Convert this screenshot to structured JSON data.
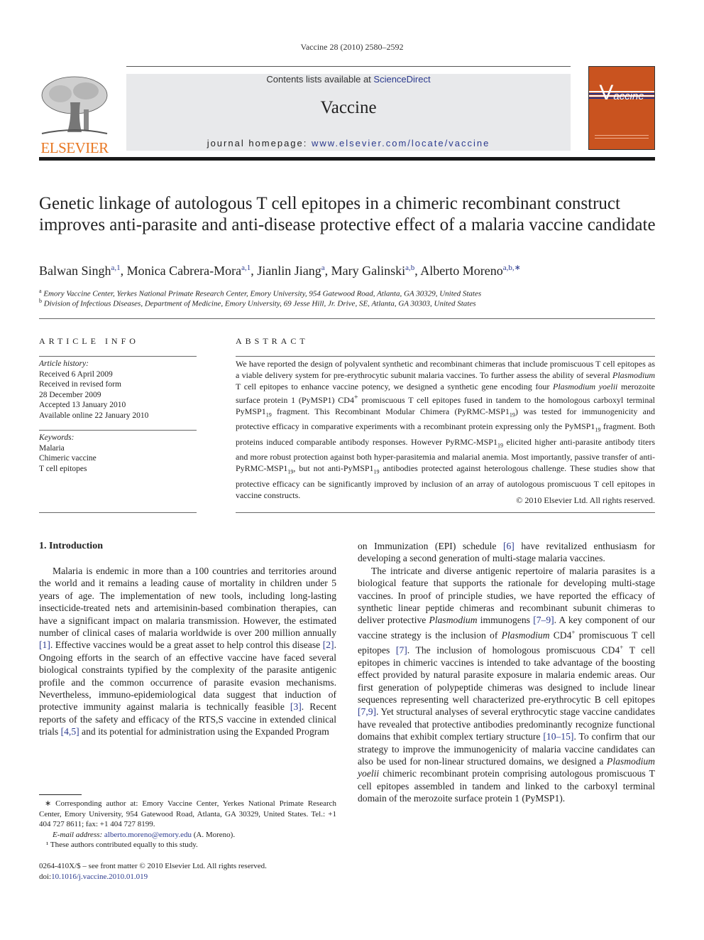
{
  "running_head": "Vaccine 28 (2010) 2580–2592",
  "publisher": {
    "logo_text": "ELSEVIER",
    "logo_color": "#e87722"
  },
  "banner": {
    "contents_prefix": "Contents lists available at ",
    "contents_link": "ScienceDirect",
    "journal_title": "Vaccine",
    "homepage_prefix": "journal homepage: ",
    "homepage_link": "www.elsevier.com/locate/vaccine"
  },
  "cover": {
    "title_v": "V",
    "title_rest": "accine",
    "color": "#c9531f"
  },
  "article": {
    "title": "Genetic linkage of autologous T cell epitopes in a chimeric recombinant construct improves anti-parasite and anti-disease protective effect of a malaria vaccine candidate",
    "authors": [
      {
        "name": "Balwan Singh",
        "sup": "a,1",
        "sep": ", "
      },
      {
        "name": "Monica Cabrera-Mora",
        "sup": "a,1",
        "sep": ", "
      },
      {
        "name": "Jianlin Jiang",
        "sup": "a",
        "sep": ", "
      },
      {
        "name": "Mary Galinski",
        "sup": "a,b",
        "sep": ", "
      },
      {
        "name": "Alberto Moreno",
        "sup": "a,b,∗",
        "sep": ""
      }
    ],
    "affiliations": [
      {
        "mark": "a",
        "text": "Emory Vaccine Center, Yerkes National Primate Research Center, Emory University, 954 Gatewood Road, Atlanta, GA 30329, United States"
      },
      {
        "mark": "b",
        "text": "Division of Infectious Diseases, Department of Medicine, Emory University, 69 Jesse Hill, Jr. Drive, SE, Atlanta, GA 30303, United States"
      }
    ]
  },
  "article_info": {
    "heading": "ARTICLE INFO",
    "history_label": "Article history:",
    "history": [
      "Received 6 April 2009",
      "Received in revised form",
      "28 December 2009",
      "Accepted 13 January 2010",
      "Available online 22 January 2010"
    ],
    "keywords_label": "Keywords:",
    "keywords": [
      "Malaria",
      "Chimeric vaccine",
      "T cell epitopes"
    ]
  },
  "abstract": {
    "heading": "ABSTRACT",
    "html": "We have reported the design of polyvalent synthetic and recombinant chimeras that include promiscuous T cell epitopes as a viable delivery system for pre-erythrocytic subunit malaria vaccines. To further assess the ability of several <i>Plasmodium</i> T cell epitopes to enhance vaccine potency, we designed a synthetic gene encoding four <i>Plasmodium yoelii</i> merozoite surface protein 1 (PyMSP1) CD4<sup>+</sup> promiscuous T cell epitopes fused in tandem to the homologous carboxyl terminal PyMSP1<sub>19</sub> fragment. This Recombinant Modular Chimera (PyRMC-MSP1<sub>19</sub>) was tested for immunogenicity and protective efficacy in comparative experiments with a recombinant protein expressing only the PyMSP1<sub>19</sub> fragment. Both proteins induced comparable antibody responses. However PyRMC-MSP1<sub>19</sub> elicited higher anti-parasite antibody titers and more robust protection against both hyper-parasitemia and malarial anemia. Most importantly, passive transfer of anti-PyRMC-MSP1<sub>19</sub>, but not anti-PyMSP1<sub>19</sub> antibodies protected against heterologous challenge. These studies show that protective efficacy can be significantly improved by inclusion of an array of autologous promiscuous T cell epitopes in vaccine constructs.",
    "copyright": "© 2010 Elsevier Ltd. All rights reserved."
  },
  "intro": {
    "heading": "1.  Introduction",
    "left_html": "Malaria is endemic in more than a 100 countries and territories around the world and it remains a leading cause of mortality in children under 5 years of age. The implementation of new tools, including long-lasting insecticide-treated nets and artemisinin-based combination therapies, can have a significant impact on malaria transmission. However, the estimated number of clinical cases of malaria worldwide is over 200 million annually <a class=\"link\">[1]</a>. Effective vaccines would be a great asset to help control this disease <a class=\"link\">[2]</a>. Ongoing efforts in the search of an effective vaccine have faced several biological constraints typified by the complexity of the parasite antigenic profile and the common occurrence of parasite evasion mechanisms. Nevertheless, immuno-epidemiological data suggest that induction of protective immunity against malaria is technically feasible <a class=\"link\">[3]</a>. Recent reports of the safety and efficacy of the RTS,S vaccine in extended clinical trials <a class=\"link\">[4,5]</a> and its potential for administration using the Expanded Program",
    "right_p1_html": "on Immunization (EPI) schedule <a class=\"link\">[6]</a> have revitalized enthusiasm for developing a second generation of multi-stage malaria vaccines.",
    "right_p2_html": "The intricate and diverse antigenic repertoire of malaria parasites is a biological feature that supports the rationale for developing multi-stage vaccines. In proof of principle studies, we have reported the efficacy of synthetic linear peptide chimeras and recombinant subunit chimeras to deliver protective <i>Plasmodium</i> immunogens <a class=\"link\">[7–9]</a>. A key component of our vaccine strategy is the inclusion of <i>Plasmodium</i> CD4<sup>+</sup> promiscuous T cell epitopes <a class=\"link\">[7]</a>. The inclusion of homologous promiscuous CD4<sup>+</sup> T cell epitopes in chimeric vaccines is intended to take advantage of the boosting effect provided by natural parasite exposure in malaria endemic areas. Our first generation of polypeptide chimeras was designed to include linear sequences representing well characterized pre-erythrocytic B cell epitopes <a class=\"link\">[7,9]</a>. Yet structural analyses of several erythrocytic stage vaccine candidates have revealed that protective antibodies predominantly recognize functional domains that exhibit complex tertiary structure <a class=\"link\">[10–15]</a>. To confirm that our strategy to improve the immunogenicity of malaria vaccine candidates can also be used for non-linear structured domains, we designed a <i>Plasmodium yoelii</i> chimeric recombinant protein comprising autologous promiscuous T cell epitopes assembled in tandem and linked to the carboxyl terminal domain of the merozoite surface protein 1 (PyMSP1)."
  },
  "footnotes": {
    "corresponding": "∗ Corresponding author at: Emory Vaccine Center, Yerkes National Primate Research Center, Emory University, 954 Gatewood Road, Atlanta, GA 30329, United States. Tel.: +1 404 727 8611; fax: +1 404 727 8199.",
    "email_label": "E-mail address:",
    "email": "alberto.moreno@emory.edu",
    "email_suffix": " (A. Moreno).",
    "equal": "¹ These authors contributed equally to this study."
  },
  "frontmatter": {
    "issn_line": "0264-410X/$ – see front matter © 2010 Elsevier Ltd. All rights reserved.",
    "doi_prefix": "doi:",
    "doi": "10.1016/j.vaccine.2010.01.019"
  }
}
